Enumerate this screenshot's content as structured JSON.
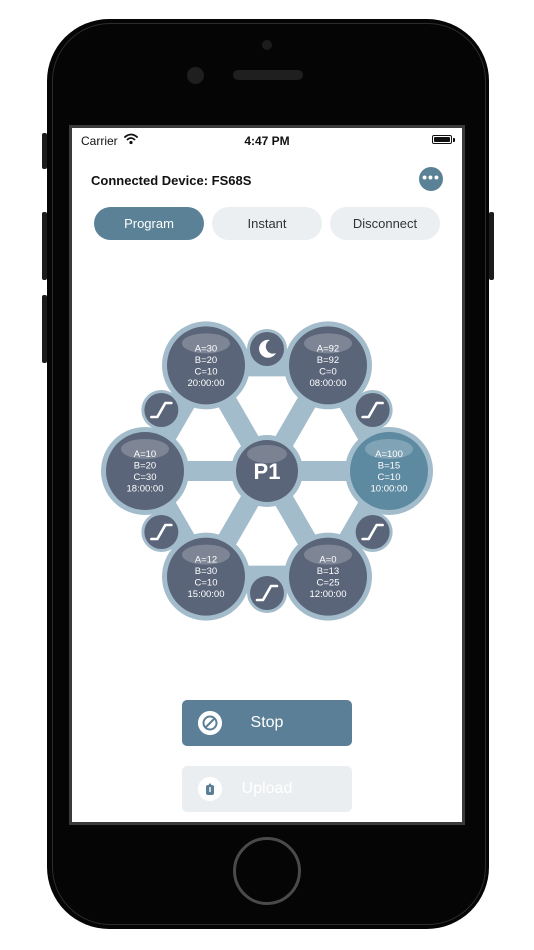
{
  "status_bar": {
    "carrier": "Carrier",
    "time": "4:47 PM"
  },
  "header": {
    "title": "Connected Device: FS68S",
    "more_icon": "ellipsis-icon"
  },
  "tabs": [
    {
      "label": "Program",
      "selected": true
    },
    {
      "label": "Instant",
      "selected": false
    },
    {
      "label": "Disconnect",
      "selected": false
    }
  ],
  "program": {
    "center_label": "P1",
    "nodes": [
      {
        "lines": [
          "A=30",
          "B=20",
          "C=10",
          "20:00:00"
        ],
        "highlighted": false
      },
      {
        "lines": [
          "A=92",
          "B=92",
          "C=0",
          "08:00:00"
        ],
        "highlighted": false
      },
      {
        "lines": [
          "A=100",
          "B=15",
          "C=10",
          "10:00:00"
        ],
        "highlighted": true
      },
      {
        "lines": [
          "A=0",
          "B=13",
          "C=25",
          "12:00:00"
        ],
        "highlighted": false
      },
      {
        "lines": [
          "A=12",
          "B=30",
          "C=10",
          "15:00:00"
        ],
        "highlighted": false
      },
      {
        "lines": [
          "A=10",
          "B=20",
          "C=30",
          "18:00:00"
        ],
        "highlighted": false
      }
    ],
    "transitions": [
      "moon-icon",
      "ramp-icon",
      "ramp-icon",
      "ramp-icon",
      "ramp-icon",
      "ramp-icon"
    ]
  },
  "actions": {
    "stop_label": "Stop",
    "stop_icon": "prohibited-icon",
    "upload_label": "Upload",
    "upload_icon": "upload-icon"
  },
  "colors": {
    "accent": "#5b8197",
    "node_fill": "#5a6579",
    "node_ring": "#a3bccb",
    "node_highlight": "#5d8aa0",
    "connector": "#a3bccb"
  }
}
